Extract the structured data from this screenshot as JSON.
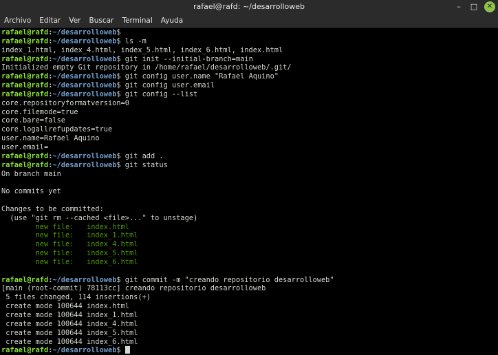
{
  "window": {
    "title": "rafael@rafd: ~/desarrolloweb",
    "minimize_glyph": "–",
    "maximize_glyph": "□",
    "close_glyph": "✕"
  },
  "menu": [
    "Archivo",
    "Editar",
    "Ver",
    "Buscar",
    "Terminal",
    "Ayuda"
  ],
  "prompt": {
    "user": "rafael@rafd",
    "sep": ":",
    "path": "~/desarrolloweb",
    "dollar": "$"
  },
  "lines": [
    {
      "type": "prompt",
      "cmd": ""
    },
    {
      "type": "prompt",
      "cmd": " ls -m"
    },
    {
      "type": "out",
      "text": "index_1.html, index_4.html, index_5.html, index_6.html, index.html"
    },
    {
      "type": "prompt",
      "cmd": " git init --initial-branch=main"
    },
    {
      "type": "out",
      "text": "Initialized empty Git repository in /home/rafael/desarrolloweb/.git/"
    },
    {
      "type": "prompt",
      "cmd": " git config user.name \"Rafael Aquino\""
    },
    {
      "type": "prompt",
      "cmd": " git config user.email"
    },
    {
      "type": "prompt",
      "cmd": " git config --list"
    },
    {
      "type": "out",
      "text": "core.repositoryformatversion=0"
    },
    {
      "type": "out",
      "text": "core.filemode=true"
    },
    {
      "type": "out",
      "text": "core.bare=false"
    },
    {
      "type": "out",
      "text": "core.logallrefupdates=true"
    },
    {
      "type": "out",
      "text": "user.name=Rafael Aquino"
    },
    {
      "type": "out",
      "text": "user.email="
    },
    {
      "type": "prompt",
      "cmd": " git add ."
    },
    {
      "type": "prompt",
      "cmd": " git status"
    },
    {
      "type": "out",
      "text": "On branch main"
    },
    {
      "type": "out",
      "text": ""
    },
    {
      "type": "out",
      "text": "No commits yet"
    },
    {
      "type": "out",
      "text": ""
    },
    {
      "type": "out",
      "text": "Changes to be committed:"
    },
    {
      "type": "out",
      "text": "  (use \"git rm --cached <file>...\" to unstage)"
    },
    {
      "type": "staged",
      "text": "\tnew file:   index.html"
    },
    {
      "type": "staged",
      "text": "\tnew file:   index_1.html"
    },
    {
      "type": "staged",
      "text": "\tnew file:   index_4.html"
    },
    {
      "type": "staged",
      "text": "\tnew file:   index_5.html"
    },
    {
      "type": "staged",
      "text": "\tnew file:   index_6.html"
    },
    {
      "type": "out",
      "text": ""
    },
    {
      "type": "prompt",
      "cmd": " git commit -m \"creando repositorio desarrolloweb\""
    },
    {
      "type": "out",
      "text": "[main (root-commit) 78113cc] creando repositorio desarrolloweb"
    },
    {
      "type": "out",
      "text": " 5 files changed, 114 insertions(+)"
    },
    {
      "type": "out",
      "text": " create mode 100644 index.html"
    },
    {
      "type": "out",
      "text": " create mode 100644 index_1.html"
    },
    {
      "type": "out",
      "text": " create mode 100644 index_4.html"
    },
    {
      "type": "out",
      "text": " create mode 100644 index_5.html"
    },
    {
      "type": "out",
      "text": " create mode 100644 index_6.html"
    },
    {
      "type": "prompt",
      "cmd": " ",
      "cursor": true
    }
  ],
  "colors": {
    "background": "#000000",
    "foreground": "#d3d7cf",
    "prompt_user": "#8ae234",
    "prompt_path": "#729fcf",
    "staged_file": "#4e9a06",
    "close_button": "#8fc24a"
  }
}
